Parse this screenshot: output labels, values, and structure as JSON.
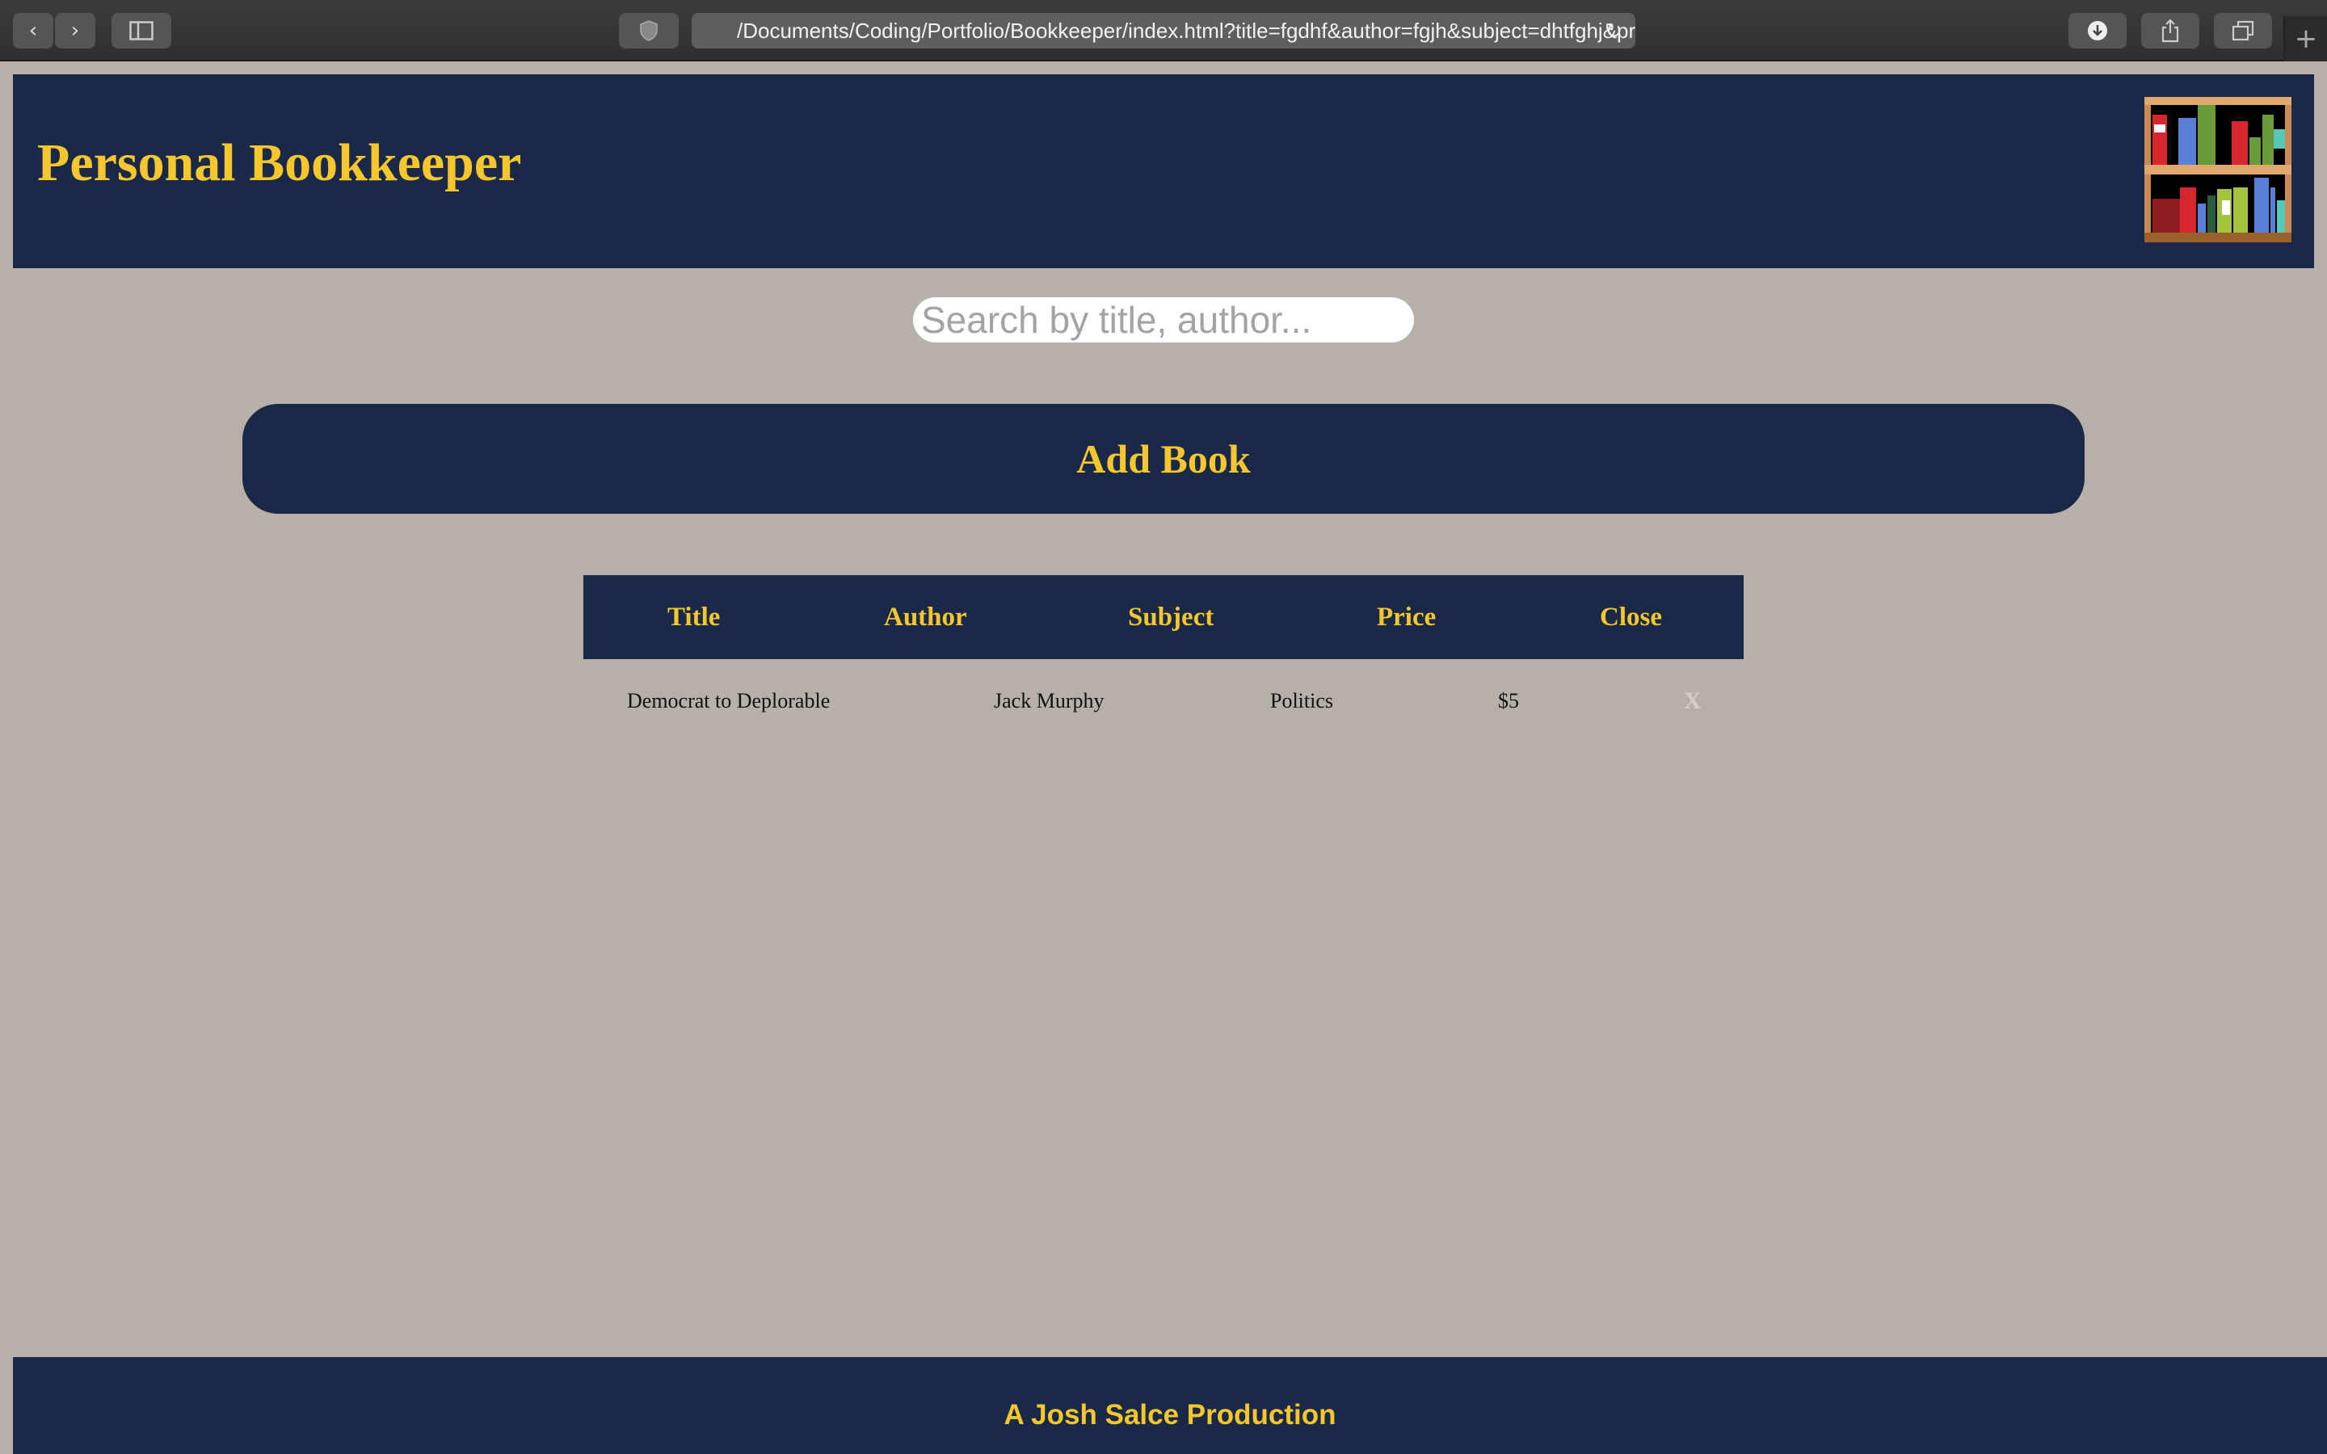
{
  "browser": {
    "url": "/Documents/Coding/Portfolio/Bookkeeper/index.html?title=fgdhf&author=fgjh&subject=dhtfghj&pr"
  },
  "site": {
    "title": "Personal Bookkeeper",
    "logo_icon": "bookshelf-icon"
  },
  "search": {
    "placeholder": "Search by title, author..."
  },
  "add_book": {
    "label": "Add Book"
  },
  "table": {
    "headers": [
      "Title",
      "Author",
      "Subject",
      "Price",
      "Close"
    ],
    "rows": [
      {
        "title": "Democrat to Deplorable",
        "author": "Jack Murphy",
        "subject": "Politics",
        "price": "$5",
        "close": "X"
      }
    ]
  },
  "footer": {
    "text": "A Josh Salce Production"
  },
  "colors": {
    "navy": "#1a2947",
    "gold": "#f6c62f",
    "background": "#b6b0a9"
  }
}
